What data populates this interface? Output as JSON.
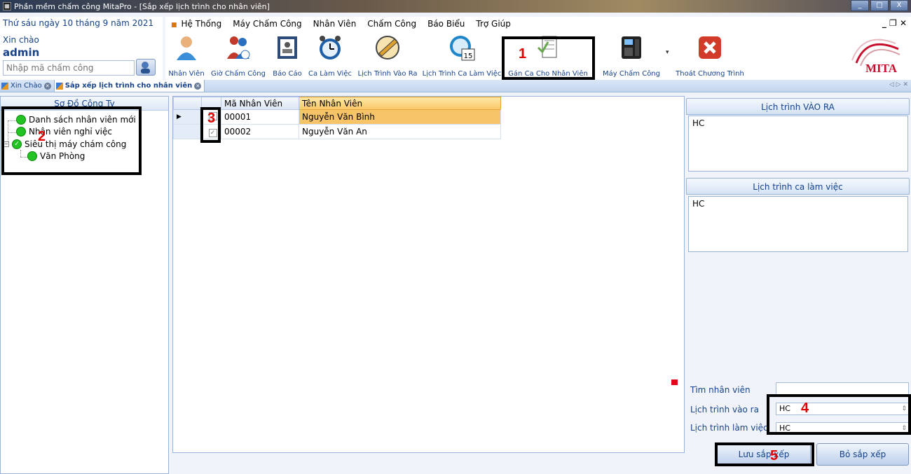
{
  "window": {
    "title": "Phần mềm chấm công MitaPro - [Sắp xếp lịch trình cho nhân viên]",
    "minimize": "_",
    "maximize": "□",
    "close": "X"
  },
  "info": {
    "date": "Thứ sáu ngày 10 tháng 9 năm 2021",
    "greeting": "Xin chào",
    "user": "admin",
    "search_placeholder": "Nhập mã chấm công"
  },
  "menu": {
    "items": [
      "Hệ Thống",
      "Máy Chấm Công",
      "Nhân Viên",
      "Chấm Công",
      "Báo Biểu",
      "Trợ Giúp"
    ],
    "mdi_controls": "_ ❐ ✕"
  },
  "ribbon": {
    "buttons": [
      {
        "label": "Nhân Viên",
        "icon": "employee-icon",
        "color": "#3a8fd8"
      },
      {
        "label": "Giờ Chấm Công",
        "icon": "people-clock-icon",
        "color": "#c0392b"
      },
      {
        "label": "Báo Cáo",
        "icon": "report-icon",
        "color": "#2c4a7a"
      },
      {
        "label": "Ca Làm Việc",
        "icon": "alarm-clock-icon",
        "color": "#2b6fc0"
      },
      {
        "label": "Lịch Trình Vào Ra",
        "icon": "schedule-pen-icon",
        "color": "#e0a030"
      },
      {
        "label": "Lịch Trình Ca Làm Việc",
        "icon": "calendar-clock-icon",
        "color": "#1f86c9"
      },
      {
        "label": "Gán Ca Cho Nhân Viên",
        "icon": "assign-list-icon",
        "color": "#6aa84f"
      },
      {
        "label": "Máy Chấm Công",
        "icon": "attendance-machine-icon",
        "color": "#333333"
      },
      {
        "label": "Thoát Chương Trình",
        "icon": "exit-icon",
        "color": "#d23a2a"
      }
    ],
    "calendar_day": "15"
  },
  "logo": {
    "text": "MITA"
  },
  "tabs": [
    {
      "label": "Xin Chào",
      "active": false
    },
    {
      "label": "Sắp xếp lịch trình cho nhân viên",
      "active": true
    }
  ],
  "tab_nav": "◁ ▷ ✕",
  "tree": {
    "header": "Sơ Đồ Công Ty",
    "nodes": [
      "Danh sách nhân viên mới",
      "Nhân viên nghỉ việc",
      "Siêu thị máy chám công",
      "Văn Phòng"
    ]
  },
  "grid": {
    "columns": [
      "Mã Nhân Viên",
      "Tên Nhân Viên"
    ],
    "rows": [
      {
        "code": "00001",
        "name": "Nguyễn Văn Bình"
      },
      {
        "code": "00002",
        "name": "Nguyễn Văn An"
      }
    ]
  },
  "right": {
    "inout_header": "Lịch trình VÀO RA",
    "inout_value": "HC",
    "shift_header": "Lịch trình ca làm việc",
    "shift_value": "HC",
    "find_label": "Tìm nhân viên",
    "inout_label": "Lịch trình vào ra",
    "inout_select": "HC",
    "work_label": "Lịch trình làm việc",
    "work_select": "HC",
    "save_button": "Lưu sắp xếp",
    "cancel_button": "Bỏ sắp xếp"
  },
  "annotations": [
    "1",
    "2",
    "3",
    "4",
    "5"
  ],
  "colors": {
    "accent": "#15428b",
    "highlight": "#f7c46a",
    "annotation": "#e00000"
  }
}
